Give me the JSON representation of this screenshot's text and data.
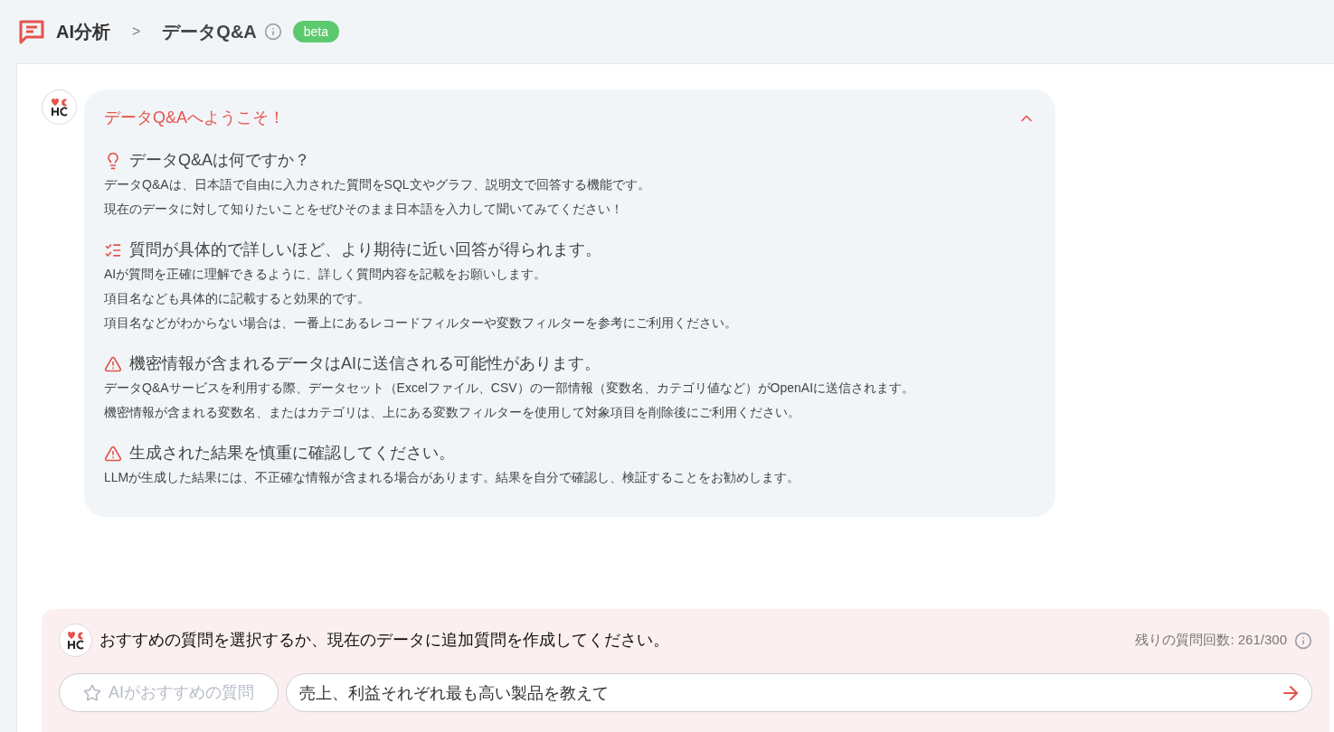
{
  "breadcrumb": {
    "parent": "AI分析",
    "separator": ">",
    "current": "データQ&A",
    "badge": "beta"
  },
  "welcome": {
    "title": "データQ&Aへようこそ！",
    "expanded": true,
    "sections": [
      {
        "kind": "bulb",
        "heading": "データQ&Aは何ですか？",
        "lines": [
          "データQ&Aは、日本語で自由に入力された質問をSQL文やグラフ、説明文で回答する機能です。",
          "現在のデータに対して知りたいことをぜひそのまま日本語を入力して聞いてみてください！"
        ]
      },
      {
        "kind": "checklist",
        "heading": "質問が具体的で詳しいほど、より期待に近い回答が得られます。",
        "lines": [
          "AIが質問を正確に理解できるように、詳しく質問内容を記載をお願いします。",
          "項目名なども具体的に記載すると効果的です。",
          "項目名などがわからない場合は、一番上にあるレコードフィルターや変数フィルターを参考にご利用ください。"
        ]
      },
      {
        "kind": "warning",
        "heading": "機密情報が含まれるデータはAIに送信される可能性があります。",
        "lines": [
          "データQ&Aサービスを利用する際、データセット（Excelファイル、CSV）の一部情報（変数名、カテゴリ値など）がOpenAIに送信されます。",
          "機密情報が含まれる変数名、またはカテゴリは、上にある変数フィルターを使用して対象項目を削除後にご利用ください。"
        ]
      },
      {
        "kind": "warning",
        "heading": "生成された結果を慎重に確認してください。",
        "lines": [
          "LLMが生成した結果には、不正確な情報が含まれる場合があります。結果を自分で確認し、検証することをお勧めします。"
        ]
      }
    ]
  },
  "prompt": {
    "message": "おすすめの質問を選択するか、現在のデータに追加質問を作成してください。",
    "remaining": "残りの質問回数: 261/300",
    "suggest_button": "AIがおすすめの質問",
    "input_value": "売上、利益それぞれ最も高い製品を教えて"
  }
}
